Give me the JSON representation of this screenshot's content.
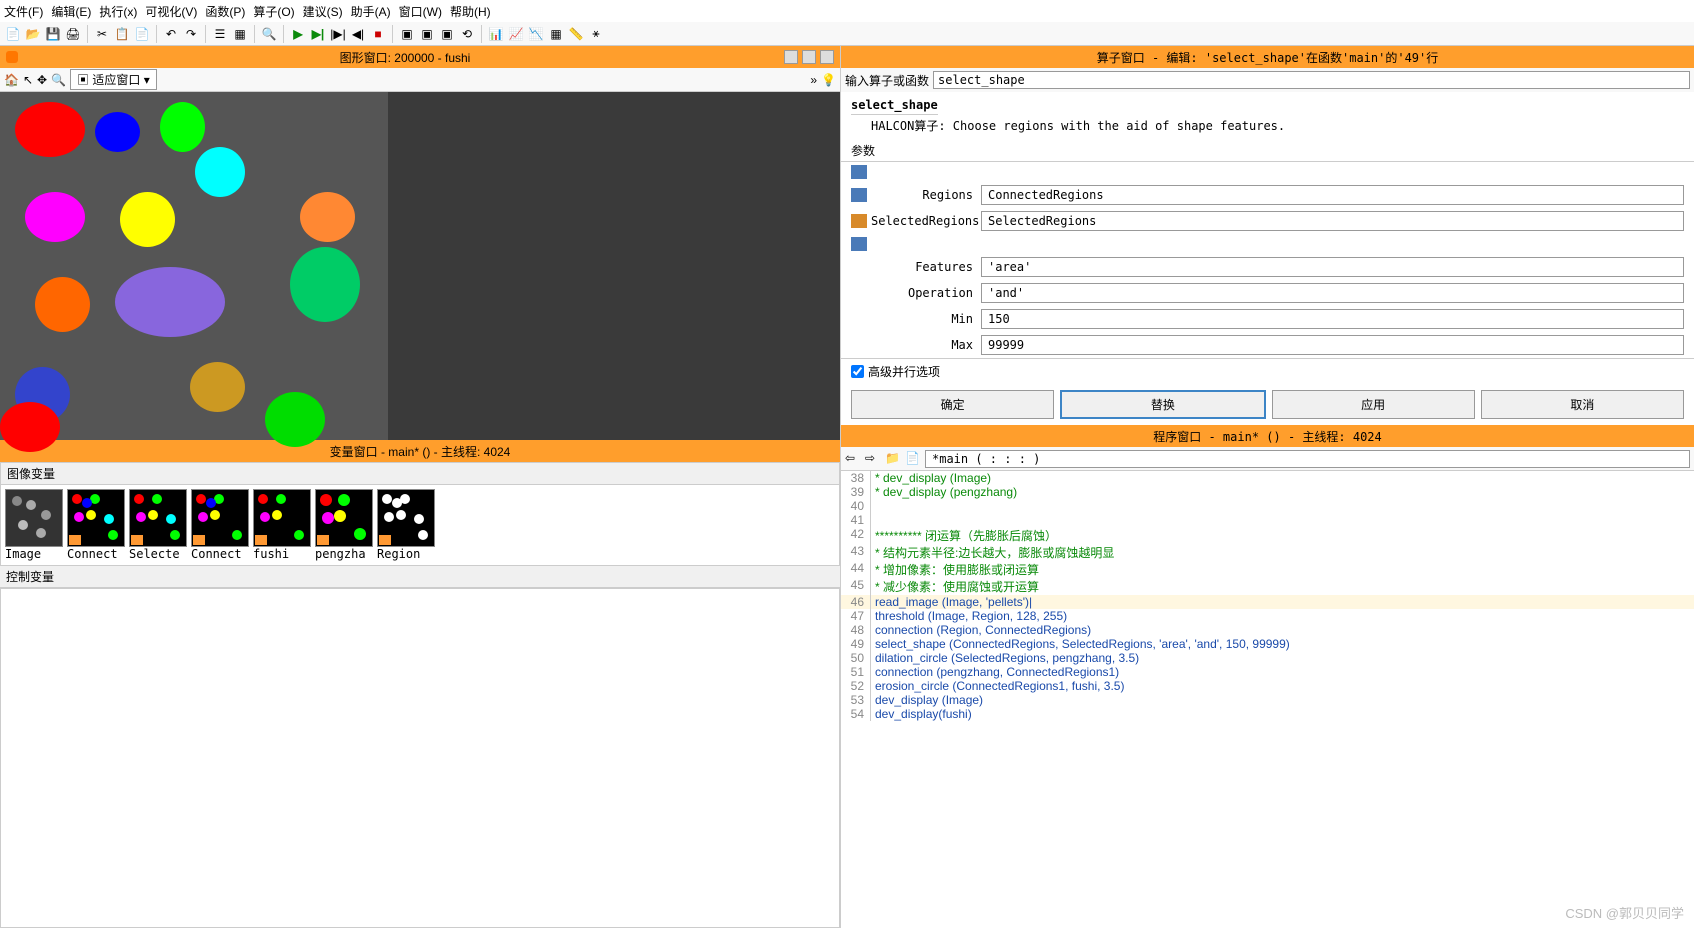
{
  "menu": [
    "文件(F)",
    "编辑(E)",
    "执行(x)",
    "可视化(V)",
    "函数(P)",
    "算子(O)",
    "建议(S)",
    "助手(A)",
    "窗口(W)",
    "帮助(H)"
  ],
  "gfx_window": {
    "title": "图形窗口: 200000 - fushi",
    "fit_label": "适应窗口",
    "more": "»"
  },
  "var_window": {
    "title": "变量窗口 - main* () - 主线程: 4024",
    "img_vars_label": "图像变量",
    "ctrl_vars_label": "控制变量"
  },
  "thumbnails": [
    {
      "label": "Image"
    },
    {
      "label": "Connect"
    },
    {
      "label": "Selecte"
    },
    {
      "label": "Connect"
    },
    {
      "label": "fushi"
    },
    {
      "label": "pengzha"
    },
    {
      "label": "Region"
    }
  ],
  "operator_window": {
    "title": "算子窗口 - 编辑: 'select_shape'在函数'main'的'49'行",
    "search_label": "输入算子或函数",
    "search_value": "select_shape",
    "op_name": "select_shape",
    "op_desc": "HALCON算子: Choose regions with the aid of shape features.",
    "params_label": "参数",
    "params": [
      {
        "label": "Regions",
        "value": "ConnectedRegions"
      },
      {
        "label": "SelectedRegions",
        "value": "SelectedRegions"
      },
      {
        "label": "Features",
        "value": "'area'"
      },
      {
        "label": "Operation",
        "value": "'and'"
      },
      {
        "label": "Min",
        "value": "150"
      },
      {
        "label": "Max",
        "value": "99999"
      }
    ],
    "adv_label": "高级并行选项",
    "buttons": {
      "ok": "确定",
      "replace": "替换",
      "apply": "应用",
      "cancel": "取消"
    }
  },
  "program_window": {
    "title": "程序窗口 - main* () - 主线程: 4024",
    "proc_name": "*main ( : : : )"
  },
  "code": [
    {
      "n": 38,
      "t": "* dev_display (Image)",
      "c": "cmt"
    },
    {
      "n": 39,
      "t": "* dev_display (pengzhang)",
      "c": "cmt"
    },
    {
      "n": 40,
      "t": "",
      "c": ""
    },
    {
      "n": 41,
      "t": "",
      "c": ""
    },
    {
      "n": 42,
      "t": "********** 闭运算（先膨胀后腐蚀）",
      "c": "cmt"
    },
    {
      "n": 43,
      "t": "* 结构元素半径:边长越大，膨胀或腐蚀越明显",
      "c": "cmt"
    },
    {
      "n": 44,
      "t": "* 增加像素：使用膨胀或闭运算",
      "c": "cmt"
    },
    {
      "n": 45,
      "t": "* 减少像素：使用腐蚀或开运算",
      "c": "cmt"
    },
    {
      "n": 46,
      "t": "read_image (Image, 'pellets')",
      "c": "call",
      "cur": true
    },
    {
      "n": 47,
      "t": "threshold (Image, Region, 128, 255)",
      "c": "call"
    },
    {
      "n": 48,
      "t": "connection (Region, ConnectedRegions)",
      "c": "call"
    },
    {
      "n": 49,
      "t": "select_shape (ConnectedRegions, SelectedRegions, 'area', 'and', 150, 99999)",
      "c": "call"
    },
    {
      "n": 50,
      "t": "dilation_circle (SelectedRegions, pengzhang, 3.5)",
      "c": "call"
    },
    {
      "n": 51,
      "t": "connection (pengzhang, ConnectedRegions1)",
      "c": "call"
    },
    {
      "n": 52,
      "t": "erosion_circle (ConnectedRegions1, fushi, 3.5)",
      "c": "call"
    },
    {
      "n": 53,
      "t": "dev_display (Image)",
      "c": "call"
    },
    {
      "n": 54,
      "t": "dev_display(fushi)",
      "c": "call"
    }
  ],
  "watermark": "CSDN @郭贝贝同学"
}
